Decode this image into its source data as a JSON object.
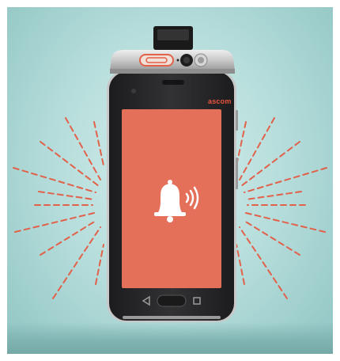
{
  "device": {
    "brand_label": "ascom"
  },
  "colors": {
    "screen": "#e4705a",
    "rays": "#e2614a",
    "phone_body": "#2b2b2d",
    "background": "#b9dfdd"
  },
  "icons": {
    "alert": "bell-ringing-icon",
    "nav_back": "back-triangle-icon",
    "nav_home": "home-button",
    "nav_recent": "recent-square-icon"
  }
}
